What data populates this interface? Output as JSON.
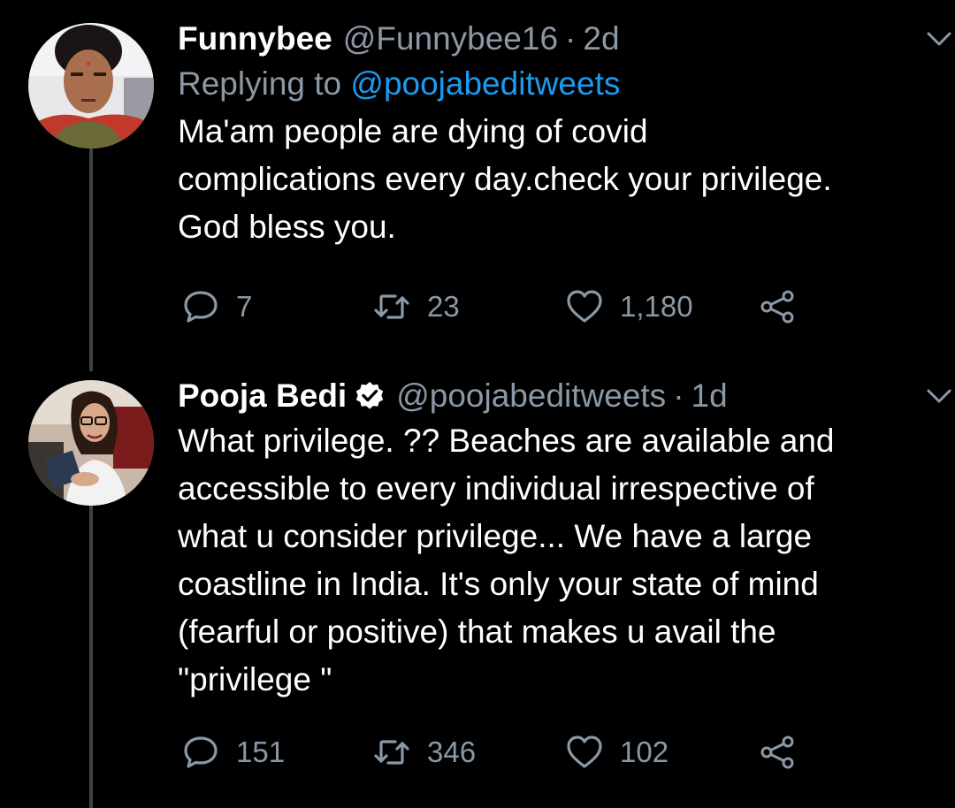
{
  "tweets": [
    {
      "author_name": "Funnybee",
      "handle": "@Funnybee16",
      "separator": "·",
      "time": "2d",
      "replying_prefix": "Replying to",
      "replying_mention": "@poojabeditweets",
      "body_lines": [
        "Ma'am people are dying of covid",
        "complications every day.check your privilege.",
        "God bless you."
      ],
      "replies": "7",
      "retweets": "23",
      "likes": "1,180",
      "verified": false
    },
    {
      "author_name": "Pooja Bedi",
      "handle": "@poojabeditweets",
      "separator": "·",
      "time": "1d",
      "body_lines": [
        "What privilege. ?? Beaches are available and",
        "accessible to every individual irrespective of",
        "what u consider privilege... We have a large",
        "coastline in India. It's only your state of mind",
        "(fearful or positive) that makes u avail the",
        "\"privilege \""
      ],
      "replies": "151",
      "retweets": "346",
      "likes": "102",
      "verified": true
    }
  ],
  "colors": {
    "background": "#000000",
    "text_primary": "#ffffff",
    "text_secondary": "#8b98a5",
    "accent": "#1d9bf0",
    "thread_line": "#3d4349"
  },
  "icons": [
    "reply-icon",
    "retweet-icon",
    "like-icon",
    "share-icon",
    "chevron-down-icon",
    "verified-badge-icon"
  ]
}
